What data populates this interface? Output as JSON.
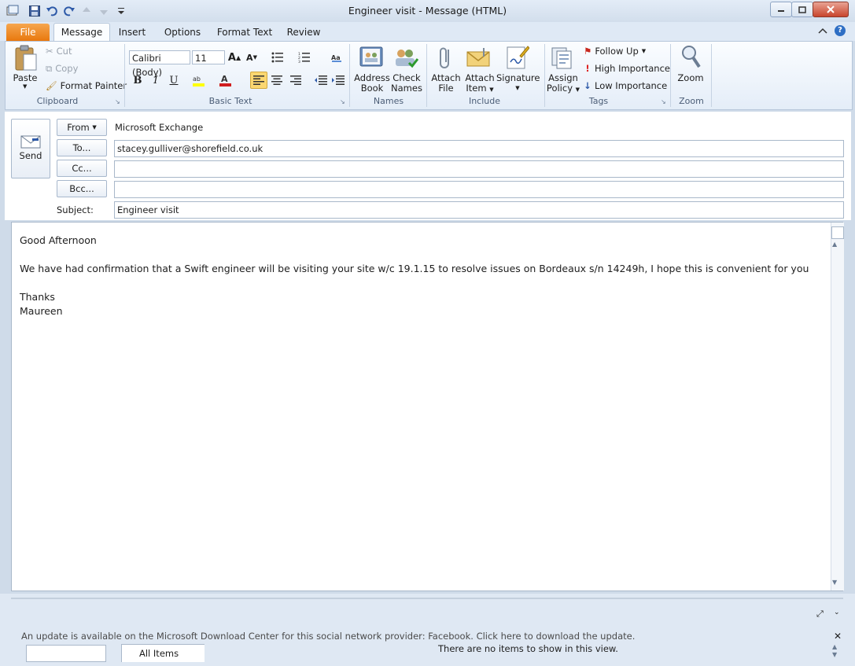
{
  "window": {
    "title": "Engineer visit  -  Message (HTML)"
  },
  "tabs": {
    "file": "File",
    "message": "Message",
    "insert": "Insert",
    "options": "Options",
    "format_text": "Format Text",
    "review": "Review"
  },
  "ribbon": {
    "clipboard": {
      "paste": "Paste",
      "cut": "Cut",
      "copy": "Copy",
      "format_painter": "Format Painter",
      "label": "Clipboard"
    },
    "basic_text": {
      "font": "Calibri (Body)",
      "size": "11",
      "label": "Basic Text"
    },
    "names": {
      "address_book_1": "Address",
      "address_book_2": "Book",
      "check_names_1": "Check",
      "check_names_2": "Names",
      "label": "Names"
    },
    "include": {
      "attach_file_1": "Attach",
      "attach_file_2": "File",
      "attach_item_1": "Attach",
      "attach_item_2": "Item",
      "signature": "Signature",
      "label": "Include"
    },
    "tags": {
      "assign_policy_1": "Assign",
      "assign_policy_2": "Policy",
      "follow_up": "Follow Up",
      "high_importance": "High Importance",
      "low_importance": "Low Importance",
      "label": "Tags"
    },
    "zoom": {
      "zoom": "Zoom",
      "label": "Zoom"
    }
  },
  "header": {
    "send": "Send",
    "from_button": "From",
    "from_value": "Microsoft Exchange",
    "to_button": "To...",
    "to_value": "stacey.gulliver@shorefield.co.uk",
    "cc_button": "Cc...",
    "cc_value": "",
    "bcc_button": "Bcc...",
    "bcc_value": "",
    "subject_label": "Subject:",
    "subject_value": "Engineer visit"
  },
  "body": {
    "greeting": "Good Afternoon",
    "line1": "We have had confirmation that a Swift engineer will be visiting your site w/c 19.1.15 to resolve issues on Bordeaux s/n 14249h, I hope this is convenient for you",
    "thanks": "Thanks",
    "signature": "Maureen"
  },
  "bottom": {
    "update_message": "An update is available on the Microsoft Download Center for this social network provider: Facebook. Click here to download the update.",
    "all_items": "All Items",
    "no_items": "There are no items to show in this view."
  }
}
